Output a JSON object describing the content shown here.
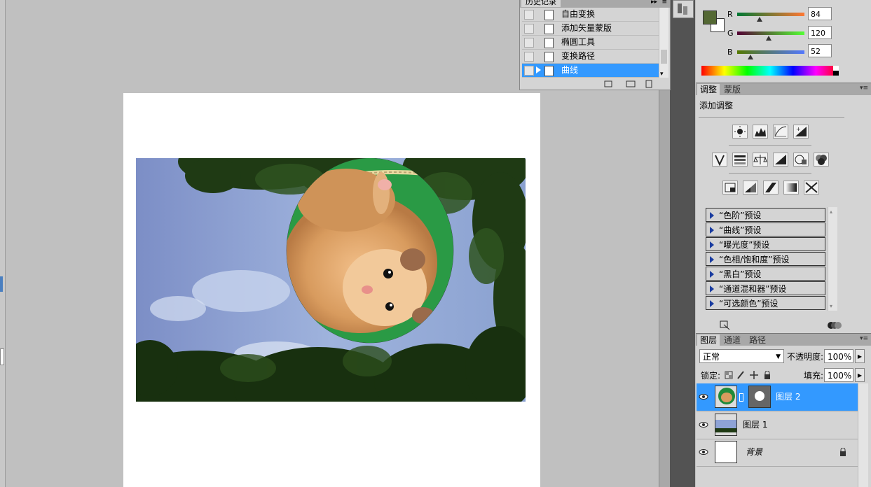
{
  "history": {
    "tab_label": "历史记录",
    "items": [
      {
        "label": "自由变换"
      },
      {
        "label": "添加矢量蒙版"
      },
      {
        "label": "椭圆工具"
      },
      {
        "label": "变换路径"
      },
      {
        "label": "曲线"
      }
    ],
    "selected_index": 4
  },
  "color_panel": {
    "foreground": "#546834",
    "r_label": "R",
    "g_label": "G",
    "b_label": "B",
    "r_value": "84",
    "g_value": "120",
    "b_value": "52",
    "r_level": 0.33,
    "g_level": 0.47,
    "b_level": 0.2
  },
  "adjustments": {
    "tabs": [
      "调整",
      "蒙版"
    ],
    "title": "添加调整",
    "presets": [
      "“色阶”预设",
      "“曲线”预设",
      "“曝光度”预设",
      "“色相/饱和度”预设",
      "“黑白”预设",
      "“通道混和器”预设",
      "“可选颜色”预设"
    ]
  },
  "layers": {
    "tabs": [
      "图层",
      "通道",
      "路径"
    ],
    "blend_mode": "正常",
    "opacity_label": "不透明度:",
    "opacity_value": "100%",
    "lock_label": "锁定:",
    "fill_label": "填充:",
    "fill_value": "100%",
    "items": [
      {
        "name": "图层 2",
        "selected": true
      },
      {
        "name": "图层 1",
        "selected": false
      },
      {
        "name": "背景",
        "selected": false
      }
    ]
  }
}
